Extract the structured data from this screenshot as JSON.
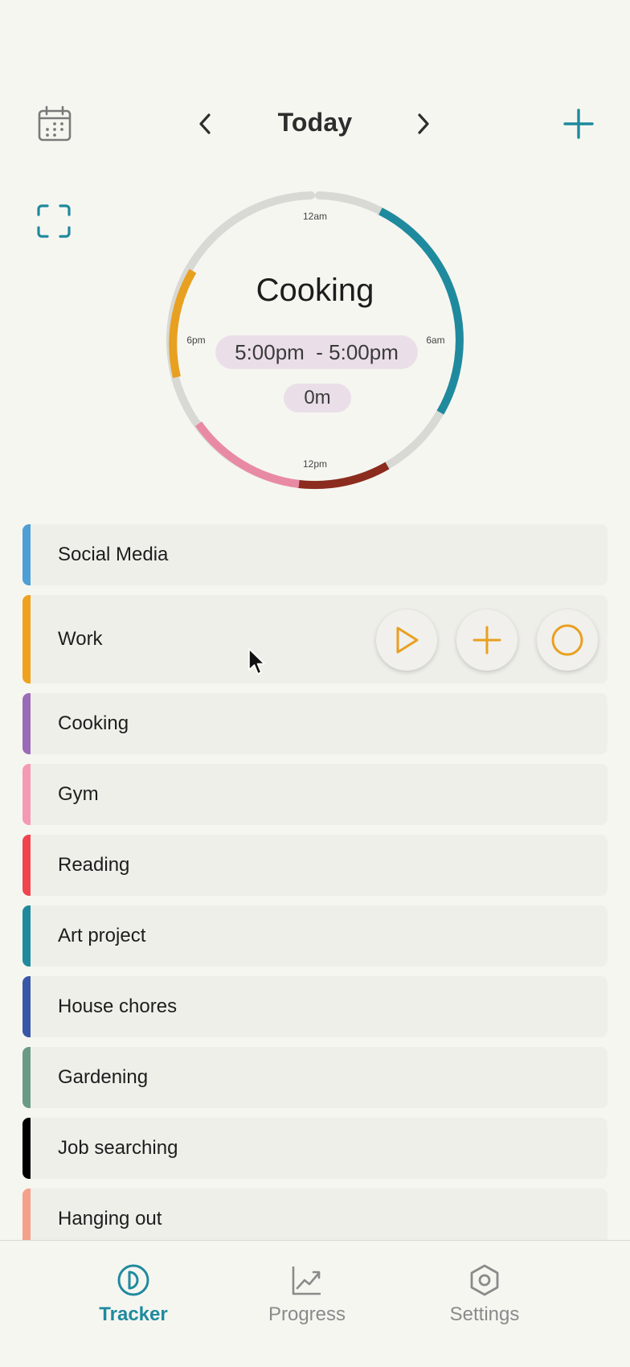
{
  "header": {
    "title": "Today",
    "calendar_icon": "calendar-icon",
    "prev_icon": "chevron-left-icon",
    "next_icon": "chevron-right-icon",
    "add_icon": "plus-icon",
    "fullscreen_icon": "fullscreen-icon"
  },
  "ring": {
    "labels": {
      "top": "12am",
      "right": "6am",
      "bottom": "12pm",
      "left": "6pm"
    },
    "current_activity": "Cooking",
    "time_range": "5:00pm  - 5:00pm",
    "duration": "0m",
    "colors": {
      "track": "#d8d8d4",
      "art_project": "#1f8a9e",
      "house_chores": "#8b2c1e",
      "gym": "#e98aa4",
      "work": "#e8a020"
    }
  },
  "activities": [
    {
      "label": "Social Media",
      "color": "#4e9fd6"
    },
    {
      "label": "Work",
      "color": "#f0a21f"
    },
    {
      "label": "Cooking",
      "color": "#9c6bb8"
    },
    {
      "label": "Gym",
      "color": "#f59ab4"
    },
    {
      "label": "Reading",
      "color": "#f0454f"
    },
    {
      "label": "Art project",
      "color": "#1f8a9e"
    },
    {
      "label": "House chores",
      "color": "#3a56a6"
    },
    {
      "label": "Gardening",
      "color": "#6a9a86"
    },
    {
      "label": "Job searching",
      "color": "#000000"
    },
    {
      "label": "Hanging out",
      "color": "#f4a08a"
    }
  ],
  "work_actions": {
    "play_icon": "play-icon",
    "add_icon": "plus-icon",
    "stop_icon": "circle-icon",
    "accent": "#e8a020"
  },
  "nav": {
    "tracker": "Tracker",
    "progress": "Progress",
    "settings": "Settings",
    "active_color": "#1f8a9e",
    "inactive_color": "#8a8a8a"
  }
}
